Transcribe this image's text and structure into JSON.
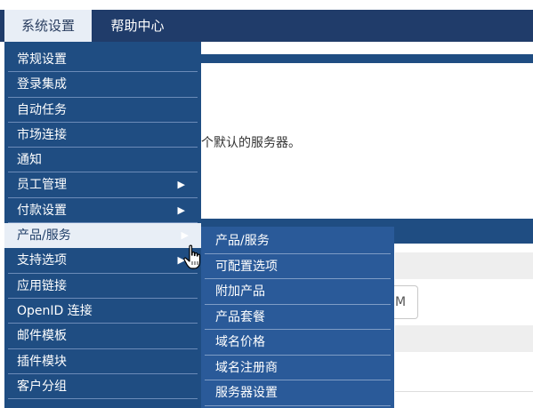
{
  "top_nav": {
    "system_settings": "系统设置",
    "help_center": "帮助中心"
  },
  "page": {
    "default_server_text": "个默认的服务器。",
    "input_partial": "M"
  },
  "menu": {
    "items": [
      {
        "label": "常规设置",
        "has_submenu": false
      },
      {
        "label": "登录集成",
        "has_submenu": false
      },
      {
        "label": "自动任务",
        "has_submenu": false
      },
      {
        "label": "市场连接",
        "has_submenu": false
      },
      {
        "label": "通知",
        "has_submenu": false
      },
      {
        "label": "员工管理",
        "has_submenu": true
      },
      {
        "label": "付款设置",
        "has_submenu": true
      },
      {
        "label": "产品/服务",
        "has_submenu": true,
        "active": true
      },
      {
        "label": "支持选项",
        "has_submenu": true
      },
      {
        "label": "应用链接",
        "has_submenu": false
      },
      {
        "label": "OpenID 连接",
        "has_submenu": false
      },
      {
        "label": "邮件模板",
        "has_submenu": false
      },
      {
        "label": "插件模块",
        "has_submenu": false
      },
      {
        "label": "客户分组",
        "has_submenu": false
      }
    ],
    "arrow_glyph": "▶"
  },
  "submenu": {
    "items": [
      {
        "label": "产品/服务"
      },
      {
        "label": "可配置选项"
      },
      {
        "label": "附加产品"
      },
      {
        "label": "产品套餐"
      },
      {
        "label": "域名价格"
      },
      {
        "label": "域名注册商"
      },
      {
        "label": "服务器设置"
      }
    ]
  },
  "colors": {
    "nav_bg": "#203c6a",
    "menu_bg": "#1f4d82",
    "submenu_bg": "#2a5a99",
    "active_bg": "#e8eef6"
  }
}
